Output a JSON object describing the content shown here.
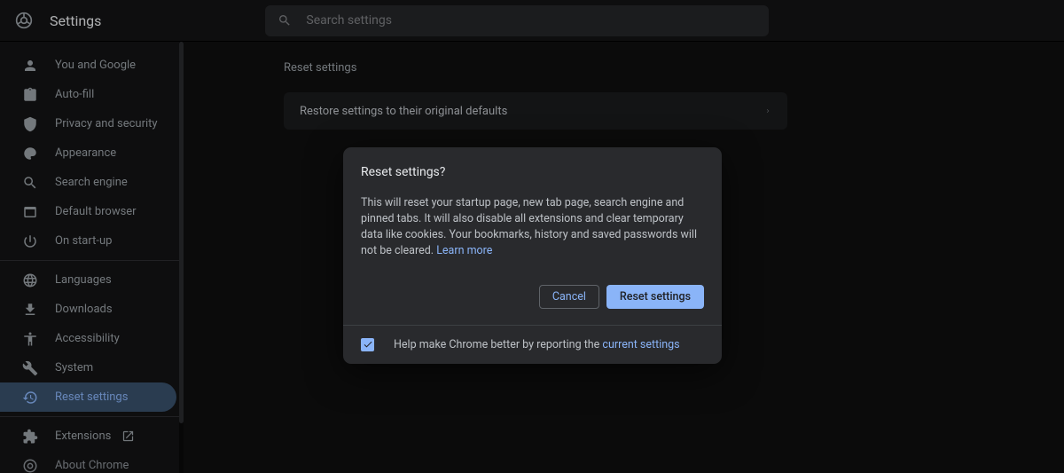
{
  "app_title": "Settings",
  "search": {
    "placeholder": "Search settings"
  },
  "sidebar": {
    "items": [
      {
        "icon": "person",
        "label": "You and Google"
      },
      {
        "icon": "clipboard",
        "label": "Auto-fill"
      },
      {
        "icon": "shield",
        "label": "Privacy and security"
      },
      {
        "icon": "palette",
        "label": "Appearance"
      },
      {
        "icon": "search",
        "label": "Search engine"
      },
      {
        "icon": "window",
        "label": "Default browser"
      },
      {
        "icon": "power",
        "label": "On start-up"
      }
    ],
    "items2": [
      {
        "icon": "globe",
        "label": "Languages"
      },
      {
        "icon": "download",
        "label": "Downloads"
      },
      {
        "icon": "accessibility",
        "label": "Accessibility"
      },
      {
        "icon": "wrench",
        "label": "System"
      },
      {
        "icon": "restore",
        "label": "Reset settings",
        "active": true
      }
    ],
    "items3": [
      {
        "icon": "puzzle",
        "label": "Extensions",
        "external": true
      },
      {
        "icon": "chrome",
        "label": "About Chrome"
      }
    ]
  },
  "main": {
    "section_title": "Reset settings",
    "row_label": "Restore settings to their original defaults"
  },
  "dialog": {
    "title": "Reset settings?",
    "body": "This will reset your startup page, new tab page, search engine and pinned tabs. It will also disable all extensions and clear temporary data like cookies. Your bookmarks, history and saved passwords will not be cleared. ",
    "learn_more": "Learn more",
    "cancel": "Cancel",
    "confirm": "Reset settings",
    "footer_pre": "Help make Chrome better by reporting the ",
    "footer_link": "current settings"
  }
}
